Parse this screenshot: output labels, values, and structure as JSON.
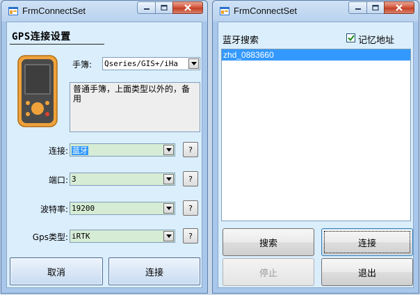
{
  "left_window": {
    "title": "FrmConnectSet",
    "heading": "GPS连接设置",
    "handbook_label": "手簿:",
    "handbook_value": "Qseries/GIS+/iHa",
    "description": "普通手簿，上面类型以外的，备用",
    "connection_label": "连接:",
    "connection_value": "蓝牙",
    "port_label": "端口:",
    "port_value": "3",
    "baud_label": "波特率:",
    "baud_value": "19200",
    "gps_type_label": "Gps类型:",
    "gps_type_value": "iRTK",
    "help_label": "?",
    "cancel_label": "取消",
    "connect_label": "连接"
  },
  "right_window": {
    "title": "FrmConnectSet",
    "bluetooth_search_label": "蓝牙搜索",
    "remember_address_label": "记忆地址",
    "remember_address_checked": true,
    "devices": [
      "zhd_0883660"
    ],
    "search_label": "搜索",
    "connect_label": "连接",
    "stop_label": "停止",
    "exit_label": "退出"
  },
  "colors": {
    "selection": "#3399ff",
    "combo_green": "#d6ecd4",
    "client_bg": "#dbeefc"
  }
}
